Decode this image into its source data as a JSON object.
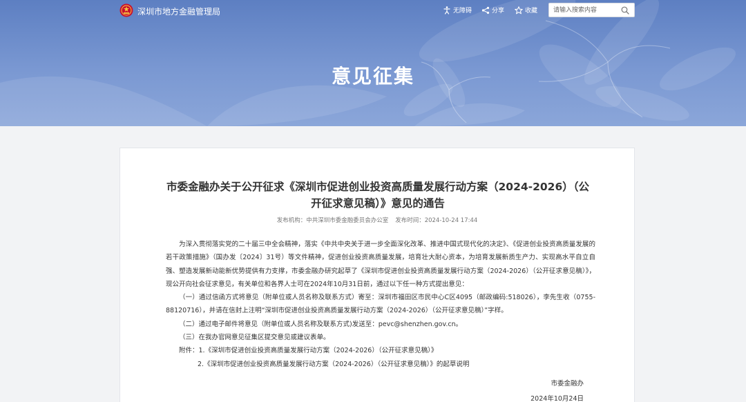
{
  "header": {
    "site_name": "深圳市地方金融管理局",
    "tools": {
      "accessibility": "无障碍",
      "share": "分享",
      "favorite": "收藏"
    },
    "search": {
      "placeholder": "请输入搜索内容"
    },
    "banner_title": "意见征集"
  },
  "article": {
    "title": "市委金融办关于公开征求《深圳市促进创业投资高质量发展行动方案（2024-2026）（公开征求意见稿）》意见的通告",
    "meta": {
      "publisher": "发布机构：中共深圳市委金融委员会办公室",
      "date": "发布时间：2024-10-24 17:44"
    },
    "intro": "为深入贯彻落实党的二十届三中全会精神，落实《中共中央关于进一步全面深化改革、推进中国式现代化的决定》、《促进创业投资高质量发展的若干政策措施》（国办发〔2024〕31号）等文件精神，促进创业投资高质量发展，培育壮大耐心资本，为培育发展新质生产力、实现高水平自立自强、塑造发展新动能新优势提供有力支撑，市委金融办研究起草了《深圳市促进创业投资高质量发展行动方案（2024-2026）（公开征求意见稿）》，现公开向社会征求意见，有关单位和各界人士可在2024年10月31日前，通过以下任一种方式提出意见：",
    "method1": "（一）通过信函方式将意见（附单位或人员名称及联系方式）寄至：深圳市福田区市民中心C区4095（邮政编码:518026），李先生收（0755-88120716），并请在信封上注明“深圳市促进创业投资高质量发展行动方案（2024-2026）（公开征求意见稿）”字样。",
    "method2": "（二）通过电子邮件将意见（附单位或人员名称及联系方式)发送至：pevc@shenzhen.gov.cn。",
    "method3": "（三）在我办官网意见征集区提交意见或建议表单。",
    "attachment1": "附件：1.《深圳市促进创业投资高质量发展行动方案（2024-2026）（公开征求意见稿）》",
    "attachment2": "2.《深圳市促进创业投资高质量发展行动方案（2024-2026）（公开征求意见稿）》的起草说明",
    "signature": "市委金融办",
    "sign_date": "2024年10月24日"
  },
  "colors": {
    "banner": "#6d8dcc",
    "panel_bg": "#ffffff",
    "page_bg": "#f2f3f5"
  }
}
